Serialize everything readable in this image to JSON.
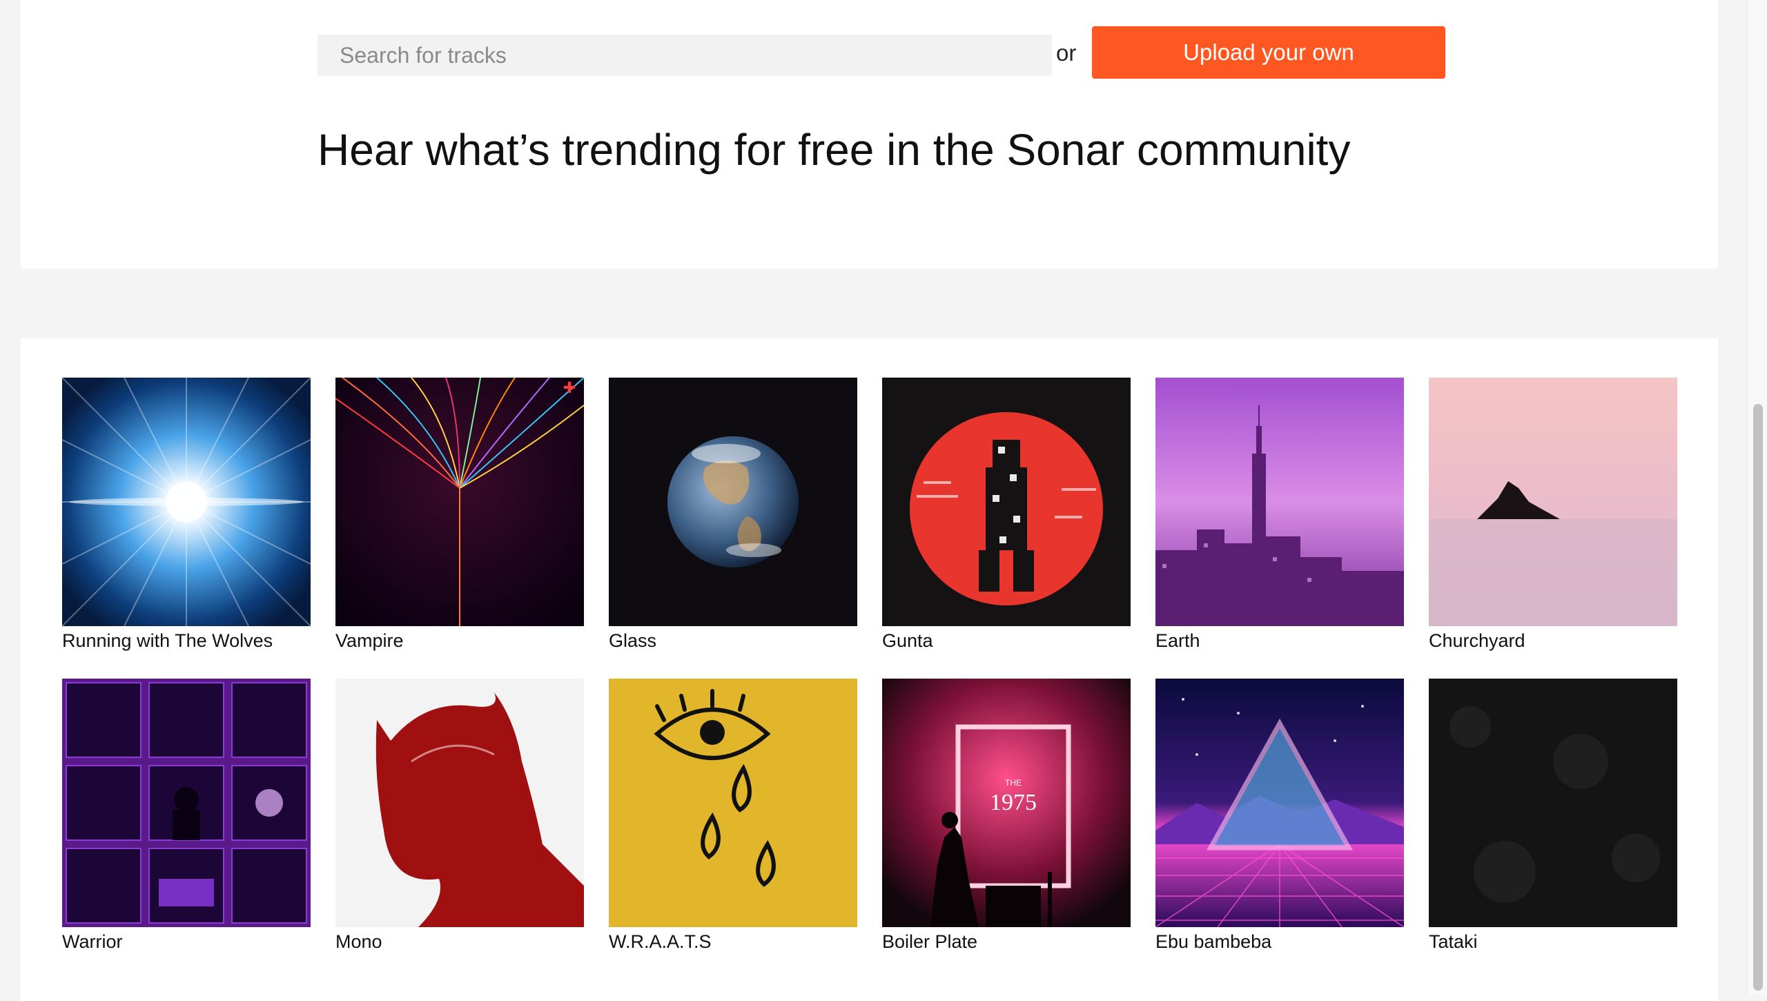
{
  "search": {
    "placeholder": "Search for tracks",
    "or_label": "or",
    "upload_label": "Upload your own"
  },
  "headline": "Hear what’s trending for free in the Sonar community",
  "theme": {
    "accent": "#ff5722"
  },
  "tracks": [
    {
      "title": "Running with The Wolves",
      "art": "light-burst"
    },
    {
      "title": "Vampire",
      "art": "color-threads"
    },
    {
      "title": "Glass",
      "art": "earth-globe"
    },
    {
      "title": "Gunta",
      "art": "red-pixel-samurai"
    },
    {
      "title": "Earth",
      "art": "purple-city-skyline"
    },
    {
      "title": "Churchyard",
      "art": "pink-sea-island"
    },
    {
      "title": "Warrior",
      "art": "purple-collage"
    },
    {
      "title": "Mono",
      "art": "red-devil-silhouette"
    },
    {
      "title": "W.R.A.A.T.S",
      "art": "crying-eye"
    },
    {
      "title": "Boiler Plate",
      "art": "neon-band-rectangle",
      "cover_text": "1975",
      "cover_small": "THE"
    },
    {
      "title": "Ebu bambeba",
      "art": "synthwave-triangle"
    },
    {
      "title": "Tataki",
      "art": "black-texture"
    }
  ]
}
